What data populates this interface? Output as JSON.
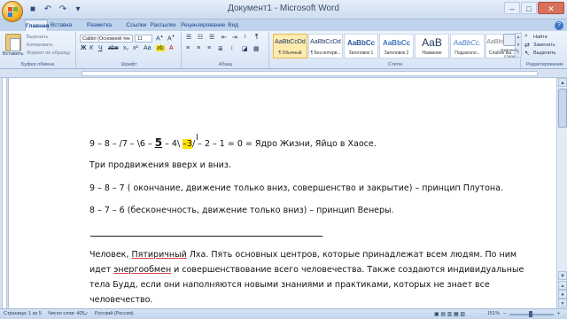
{
  "window": {
    "title": "Документ1 - Microsoft Word",
    "controls": [
      "–",
      "□",
      "✕"
    ]
  },
  "tabs": [
    "Главная",
    "Вставка",
    "Разметка страницы",
    "Ссылки",
    "Рассылки",
    "Рецензирование",
    "Вид"
  ],
  "ribbon": {
    "clipboard": {
      "paste": "Вставить",
      "cut": "Вырезать",
      "copy": "Копировать",
      "format_painter": "Формат по образцу",
      "label": "Буфер обмена"
    },
    "font": {
      "name": "Calibri (Основной тек",
      "size": "11",
      "label": "Шрифт"
    },
    "paragraph": {
      "label": "Абзац"
    },
    "styles": {
      "label": "Стили",
      "items": [
        {
          "sample": "AaBbCcDd",
          "name": "¶ Обычный"
        },
        {
          "sample": "AaBbCcDd",
          "name": "¶ Без интерв..."
        },
        {
          "sample": "AaBbCc",
          "name": "Заголовок 1"
        },
        {
          "sample": "AaBbCc",
          "name": "Заголовок 2"
        },
        {
          "sample": "AaB",
          "name": "Название"
        },
        {
          "sample": "AaBbCc.",
          "name": "Подзаголо..."
        },
        {
          "sample": "AaBbCcDd",
          "name": "Слабое вы..."
        }
      ],
      "change_styles": "Изменить стили"
    },
    "editing": {
      "find": "Найти",
      "replace": "Заменить",
      "select": "Выделить",
      "label": "Редактирование"
    }
  },
  "document": {
    "line1": {
      "pre": "9 – 8 – /7 – \\6 – ",
      "big": "5",
      "mid": " – 4\\ ",
      "hl": "–3",
      "post": "/ – 2 – 1 = 0 = Ядро Жизни, Яйцо в Хаосе."
    },
    "line2": "Три продвижения вверх и вниз.",
    "line3": "9 – 8 – 7 ( окончание, движение только вниз, совершенство и закрытие) – принцип Плутона.",
    "line4": "8 – 7 – 6  (бесконечность, движение только вниз) – принцип Венеры.",
    "para": {
      "w1": "Человек, ",
      "u1": "Пятиричный",
      "w2": " Лха. Пять основных центров, которые принадлежат всем людям. По ним",
      "w3": "идет ",
      "u2": "энергообмен",
      "w4": " и совершенствование всего человечества. Также создаются индивидуальные",
      "w5": "тела Будд, если они наполняются новыми знаниями и практиками, которых не знает все",
      "w6": "человечество."
    }
  },
  "status": {
    "page": "Страница: 1 из 5",
    "words": "Число слов: 405",
    "language": "Русский (Россия)",
    "zoom": "151%"
  }
}
